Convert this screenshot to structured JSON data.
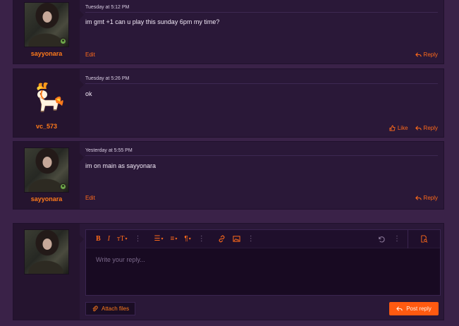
{
  "posts": [
    {
      "username": "sayyonara",
      "date": "Tuesday at 5:12 PM",
      "message": "im gmt +1 can u play this sunday 6pm my time?",
      "edit_label": "Edit",
      "reply_label": "Reply"
    },
    {
      "username": "vc_573",
      "date": "Tuesday at 5:26 PM",
      "message": "ok",
      "like_label": "Like",
      "reply_label": "Reply"
    },
    {
      "username": "sayyonara",
      "date": "Yesterday at 5:55 PM",
      "message": "im on main as sayyonara",
      "edit_label": "Edit",
      "reply_label": "Reply"
    }
  ],
  "editor": {
    "placeholder": "Write your reply...",
    "attach_label": "Attach files",
    "post_reply_label": "Post reply",
    "toolbar_icons": [
      "bold-icon",
      "italic-icon",
      "text-size-icon",
      "more-icon",
      "list-icon",
      "align-icon",
      "paragraph-icon",
      "more-icon",
      "link-icon",
      "image-icon",
      "more-icon",
      "undo-icon",
      "more-icon",
      "preview-icon"
    ]
  },
  "colors": {
    "accent": "#ff6a1a",
    "post_bg": "#2a1838",
    "page_bg": "#3a2248"
  }
}
